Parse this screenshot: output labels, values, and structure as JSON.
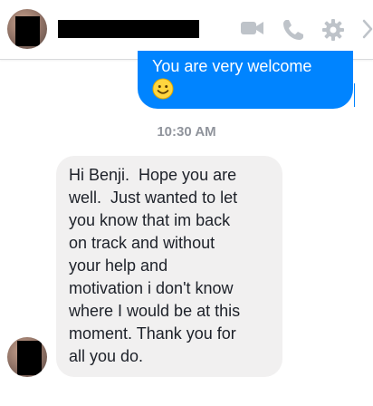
{
  "header": {
    "icons": [
      "video-camera-icon",
      "phone-icon",
      "gear-icon",
      "chevron-right-icon"
    ],
    "icon_color": "#bec3c9"
  },
  "sent_message": {
    "text": "You are very welcome",
    "emoji": "smiley-face-emoji",
    "bubble_color": "#0084ff"
  },
  "timestamp": "10:30 AM",
  "received_message": {
    "lines": [
      "Hi Benji.  Hope you are",
      "well.  Just wanted to let",
      "you know that im back",
      "on track and without",
      "your help and",
      "motivation i don't know",
      "where I would be at this",
      "moment. Thank you for",
      "all you do."
    ],
    "bubble_color": "#f1f0f0"
  }
}
